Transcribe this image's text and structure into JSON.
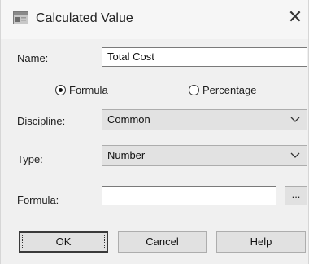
{
  "window": {
    "title": "Calculated Value",
    "close_glyph": "✕",
    "title_icon": "window-icon"
  },
  "form": {
    "name_label": "Name:",
    "name_value": "Total Cost",
    "radio_formula": {
      "label": "Formula",
      "selected": true
    },
    "radio_percentage": {
      "label": "Percentage",
      "selected": false
    },
    "discipline_label": "Discipline:",
    "discipline_value": "Common",
    "type_label": "Type:",
    "type_value": "Number",
    "formula_label": "Formula:",
    "formula_value": "",
    "ellipsis_label": "..."
  },
  "buttons": {
    "ok": "OK",
    "cancel": "Cancel",
    "help": "Help"
  },
  "colors": {
    "body_bg": "#f0f0f0",
    "titlebar_bg": "#f6f6f6",
    "combo_bg": "#e2e2e2",
    "button_bg": "#e1e1e1"
  }
}
